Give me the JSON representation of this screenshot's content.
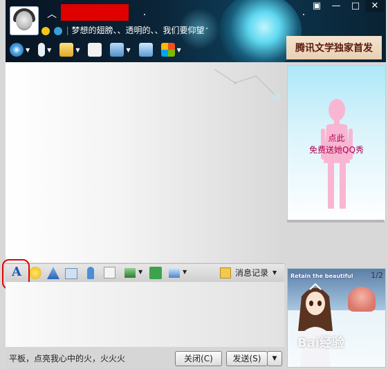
{
  "header": {
    "mood": "梦想的翅膀、、透明的、、我们要仰望",
    "title_buttons": {
      "menu": "▣",
      "minimize": "—",
      "maximize": "□",
      "close": "✕"
    },
    "ad_text": "腾讯文学独家首发"
  },
  "show_panel": {
    "line1": "点此",
    "line2": "免费送她QQ秀"
  },
  "input_toolbar": {
    "font_label": "A",
    "history_label": "消息记录"
  },
  "bottom": {
    "status": "平板，点亮我心中的火，火火火",
    "close_label": "关闭(C)",
    "send_label": "发送(S)",
    "send_dropdown": "▼"
  },
  "ad": {
    "title": "Retain the beautiful",
    "page": "1/2",
    "watermark": "Bai经验"
  },
  "colors": {
    "accent_red": "#e00000",
    "link_blue": "#1c55b8",
    "show_text": "#b00050"
  }
}
